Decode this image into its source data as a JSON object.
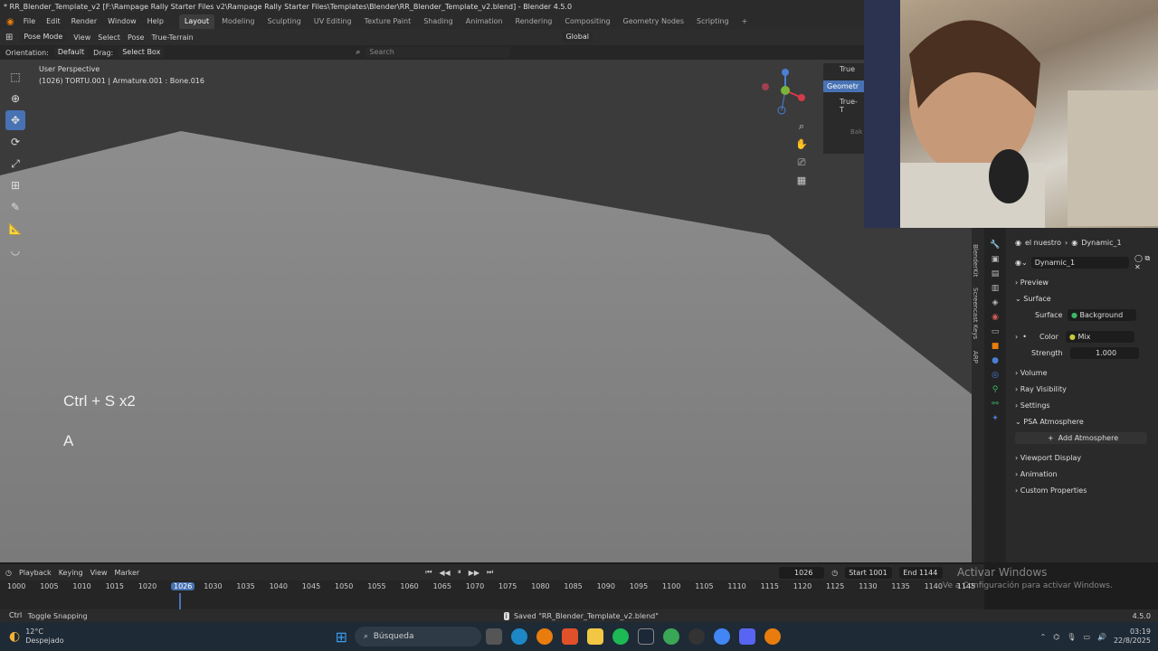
{
  "window": {
    "title": "* RR_Blender_Template_v2 [F:\\Rampage Rally Starter Files v2\\Rampage Rally Starter Files\\Templates\\Blender\\RR_Blender_Template_v2.blend] - Blender 4.5.0"
  },
  "menubar": {
    "menus": [
      "File",
      "Edit",
      "Render",
      "Window",
      "Help"
    ],
    "workspaces": [
      "Layout",
      "Modeling",
      "Sculpting",
      "UV Editing",
      "Texture Paint",
      "Shading",
      "Animation",
      "Rendering",
      "Compositing",
      "Geometry Nodes",
      "Scripting"
    ],
    "active_workspace": "Layout",
    "add_label": "+"
  },
  "header": {
    "mode": "Pose Mode",
    "menus": [
      "View",
      "Select",
      "Pose",
      "True-Terrain"
    ],
    "transform": "Global",
    "orientation_label": "Orientation:",
    "orientation_value": "Default",
    "drag_label": "Drag:",
    "drag_value": "Select Box",
    "search_placeholder": "Search"
  },
  "viewport": {
    "perspective": "User Perspective",
    "object_info": "(1026) TORTU.001 | Armature.001 : Bone.016",
    "key_overlay_1": "Ctrl + S x2",
    "key_overlay_2": "A",
    "npanel_tab1": "Geometr",
    "npanel_tab2": "True-T",
    "npanel_tab3": "Bak",
    "npanel_top": "True"
  },
  "side_tabs": [
    "BlenderKit",
    "Screencast Keys",
    "ARP"
  ],
  "properties": {
    "breadcrumb_world": "el nuestro",
    "breadcrumb_node": "Dynamic_1",
    "world_name": "Dynamic_1",
    "sections": {
      "preview": "Preview",
      "surface": "Surface",
      "volume": "Volume",
      "ray_visibility": "Ray Visibility",
      "settings": "Settings",
      "psa": "PSA Atmosphere",
      "viewport_display": "Viewport Display",
      "animation": "Animation",
      "custom_properties": "Custom Properties"
    },
    "surface_label": "Surface",
    "surface_value": "Background",
    "color_label": "Color",
    "color_value": "Mix",
    "strength_label": "Strength",
    "strength_value": "1.000",
    "add_atmosphere": "Add Atmosphere"
  },
  "timeline": {
    "menus": [
      "Playback",
      "Keying",
      "View",
      "Marker"
    ],
    "current_frame": "1026",
    "start_label": "Start",
    "start_value": "1001",
    "end_label": "End",
    "end_value": "1144",
    "ticks": [
      "1000",
      "1005",
      "1010",
      "1015",
      "1020",
      "1026",
      "1030",
      "1035",
      "1040",
      "1045",
      "1050",
      "1055",
      "1060",
      "1065",
      "1070",
      "1075",
      "1080",
      "1085",
      "1090",
      "1095",
      "1100",
      "1105",
      "1110",
      "1115",
      "1120",
      "1125",
      "1130",
      "1135",
      "1140",
      "1145"
    ]
  },
  "statusbar": {
    "hint_key": "Ctrl",
    "hint": "Toggle Snapping",
    "saved": "Saved \"RR_Blender_Template_v2.blend\"",
    "version": "4.5.0"
  },
  "watermark": {
    "line1": "Activar Windows",
    "line2": "Ve a Configuración para activar Windows."
  },
  "taskbar": {
    "weather_temp": "12°C",
    "weather_desc": "Despejado",
    "search_label": "Búsqueda",
    "time": "03:19",
    "date": "22/8/2025"
  },
  "colors": {
    "accent": "#4772b3",
    "playhead": "#4772b3",
    "taskbar": "#1e2a36"
  }
}
